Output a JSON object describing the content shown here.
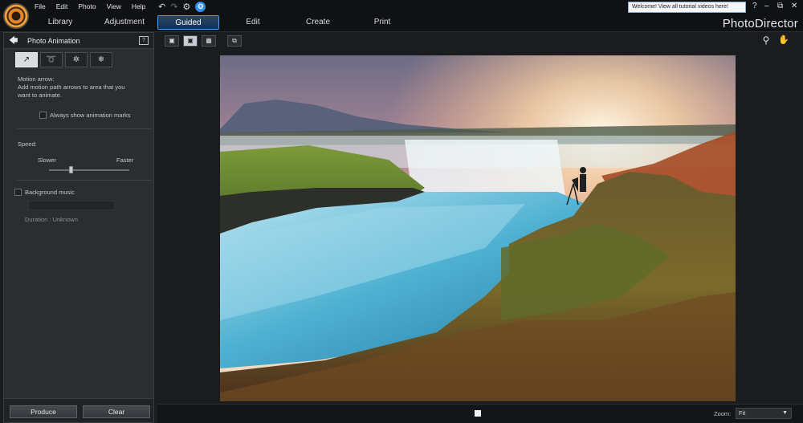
{
  "menu": [
    "File",
    "Edit",
    "Photo",
    "View",
    "Help"
  ],
  "quick_icons": {
    "undo": "↶",
    "redo": "↷",
    "settings": "⚙",
    "help": "❂"
  },
  "notification": "Welcome! View all tutorial videos here!",
  "window_controls": {
    "help": "?",
    "minimize": "–",
    "restore": "⧉",
    "close": "✕"
  },
  "modes": [
    {
      "label": "Library",
      "active": false
    },
    {
      "label": "Adjustment",
      "active": false
    },
    {
      "label": "Guided",
      "active": true
    },
    {
      "label": "Edit",
      "active": false
    },
    {
      "label": "Create",
      "active": false
    },
    {
      "label": "Print",
      "active": false
    }
  ],
  "brand": "PhotoDirector",
  "panel": {
    "back_icon": "🡄",
    "title": "Photo Animation",
    "tools": [
      "↗",
      "➰",
      "✲",
      "❄"
    ],
    "motion_heading": "Motion arrow:",
    "motion_desc_1": "Add motion path arrows to area that you",
    "motion_desc_2": "want to animate.",
    "always_show": "Always show animation marks",
    "speed_label": "Speed:",
    "slower": "Slower",
    "faster": "Faster",
    "speed_value": 0.3,
    "bg_music": "Background music",
    "duration": "Duration : Unknown",
    "produce": "Produce",
    "clear": "Clear"
  },
  "viewer": {
    "view_buttons": [
      "▣",
      "▣",
      "▦"
    ],
    "compare_icon": "⧉",
    "zoom_tool_icon": "⚲",
    "hand_tool_icon": "✋"
  },
  "status": {
    "zoom_label": "Zoom:",
    "zoom_value": "Fit",
    "caret": "▼"
  }
}
